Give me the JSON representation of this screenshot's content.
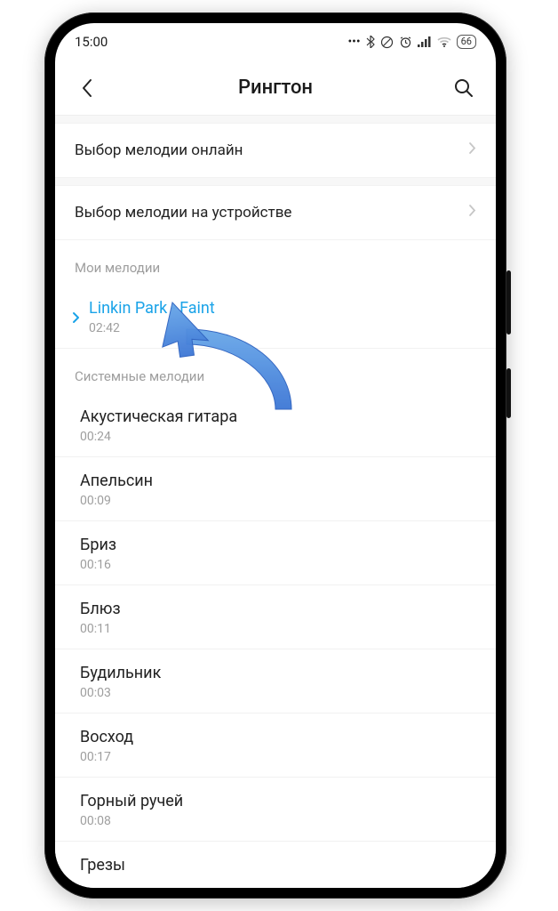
{
  "statusbar": {
    "time": "15:00",
    "battery": "66"
  },
  "appbar": {
    "title": "Рингтон"
  },
  "nav": {
    "online": "Выбор мелодии онлайн",
    "device": "Выбор мелодии на устройстве"
  },
  "sections": {
    "my": "Мои мелодии",
    "system": "Системные мелодии"
  },
  "my_ringtones": [
    {
      "name": "Linkin Park - Faint",
      "duration": "02:42",
      "selected": true
    }
  ],
  "system_ringtones": [
    {
      "name": "Акустическая гитара",
      "duration": "00:24"
    },
    {
      "name": "Апельсин",
      "duration": "00:09"
    },
    {
      "name": "Бриз",
      "duration": "00:16"
    },
    {
      "name": "Блюз",
      "duration": "00:11"
    },
    {
      "name": "Будильник",
      "duration": "00:03"
    },
    {
      "name": "Восход",
      "duration": "00:17"
    },
    {
      "name": "Горный ручей",
      "duration": "00:08"
    },
    {
      "name": "Грезы",
      "duration": ""
    }
  ]
}
